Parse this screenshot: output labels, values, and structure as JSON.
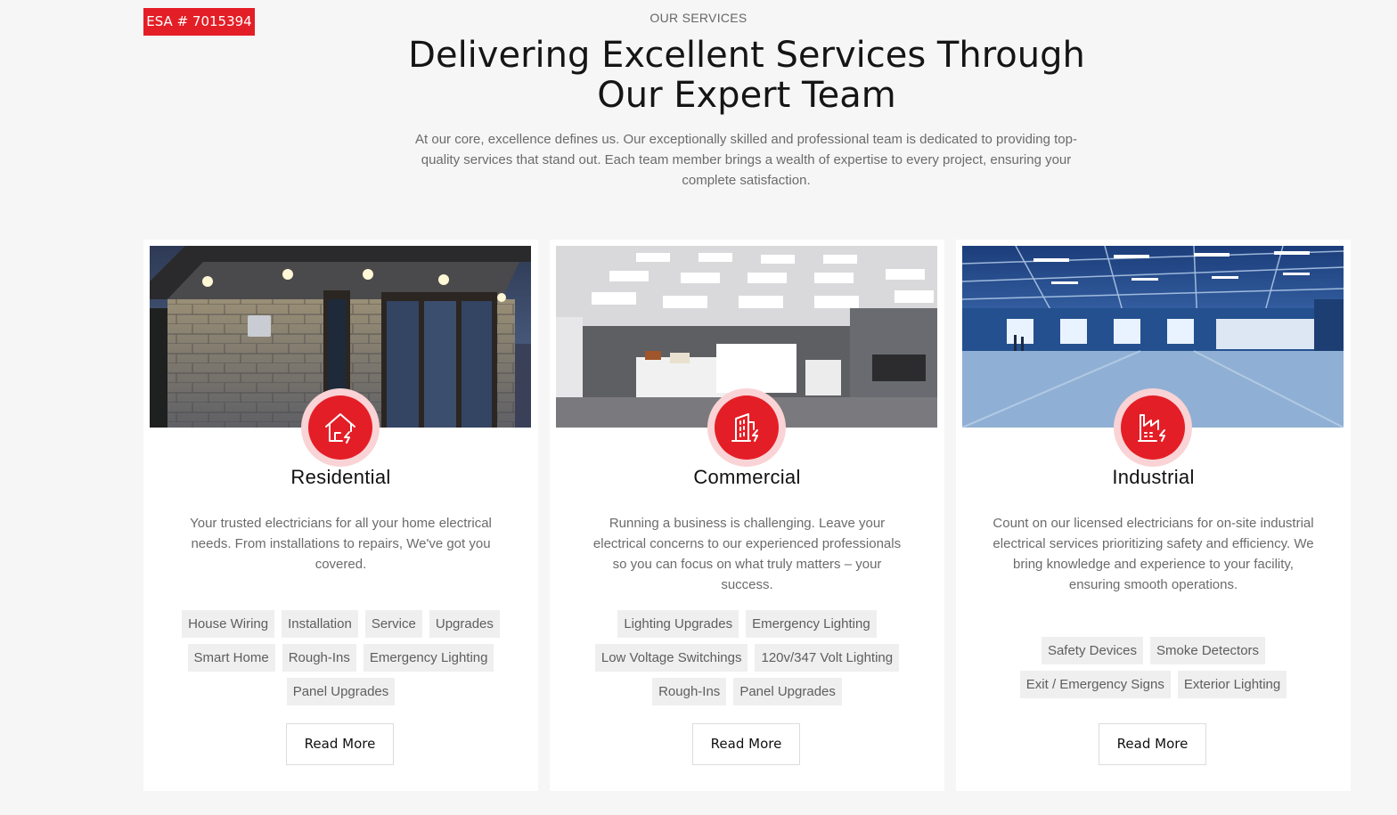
{
  "badge": "ESA # 7015394",
  "section": {
    "eyebrow": "OUR SERVICES",
    "headline": "Delivering Excellent Services Through Our Expert Team",
    "intro": "At our core, excellence defines us. Our exceptionally skilled and professional team is dedicated to providing top-quality services that stand out. Each team member brings a wealth of expertise to every project, ensuring your complete satisfaction."
  },
  "colors": {
    "accent": "#e41e26",
    "accent_soft": "#f9d3d5",
    "background": "#f6f6f6",
    "tag_bg": "#efefef"
  },
  "cards": [
    {
      "title": "Residential",
      "icon": "house-bolt-icon",
      "image": "stone-house-exterior-lights-photo",
      "description": "Your trusted electricians for all your home electrical needs. From installations to repairs, We've got you covered.",
      "tags": [
        "House Wiring",
        "Installation",
        "Service",
        "Upgrades",
        "Smart Home",
        "Rough-Ins",
        "Emergency Lighting",
        "Panel Upgrades"
      ],
      "button": "Read More"
    },
    {
      "title": "Commercial",
      "icon": "building-bolt-icon",
      "image": "office-interior-ceiling-lights-photo",
      "description": "Running a business is challenging. Leave your electrical concerns to our experienced professionals so you can focus on what truly matters – your success.",
      "tags": [
        "Lighting Upgrades",
        "Emergency Lighting",
        "Low Voltage Switchings",
        "120v/347 Volt Lighting",
        "Rough-Ins",
        "Panel Upgrades"
      ],
      "button": "Read More"
    },
    {
      "title": "Industrial",
      "icon": "factory-bolt-icon",
      "image": "warehouse-interior-photo",
      "description": "Count on our licensed electricians for on-site industrial electrical services prioritizing safety and efficiency. We bring knowledge and experience to your facility, ensuring smooth operations.",
      "tags": [
        "Safety Devices",
        "Smoke Detectors",
        "Exit / Emergency Signs",
        "Exterior Lighting"
      ],
      "button": "Read More"
    }
  ]
}
